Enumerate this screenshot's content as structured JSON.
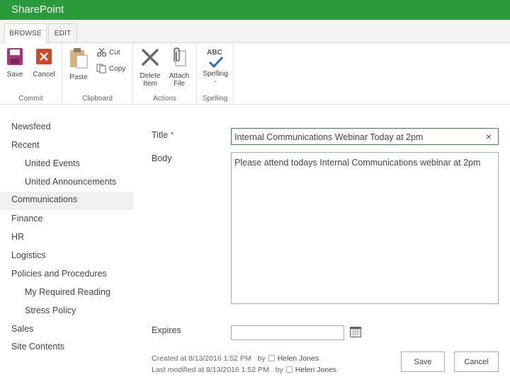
{
  "app": {
    "title": "SharePoint"
  },
  "ribbon_tabs": [
    {
      "label": "BROWSE"
    },
    {
      "label": "EDIT"
    }
  ],
  "ribbon": {
    "commit": {
      "label": "Commit",
      "save": "Save",
      "cancel": "Cancel"
    },
    "clipboard": {
      "label": "Clipboard",
      "paste": "Paste",
      "cut": "Cut",
      "copy": "Copy"
    },
    "actions": {
      "label": "Actions",
      "delete_line1": "Delete",
      "delete_line2": "Item",
      "attach_line1": "Attach",
      "attach_line2": "File"
    },
    "spelling": {
      "label": "Spelling",
      "button": "Spelling",
      "arrow": "-",
      "icon_text": "ABC"
    }
  },
  "nav": [
    {
      "label": "Newsfeed"
    },
    {
      "label": "Recent"
    },
    {
      "label": "United Events"
    },
    {
      "label": "United Announcements"
    },
    {
      "label": "Communications"
    },
    {
      "label": "Finance"
    },
    {
      "label": "HR"
    },
    {
      "label": "Logistics"
    },
    {
      "label": "Policies and Procedures"
    },
    {
      "label": "My Required Reading"
    },
    {
      "label": "Stress Policy"
    },
    {
      "label": "Sales"
    },
    {
      "label": "Site Contents"
    }
  ],
  "form": {
    "title_label": "Title",
    "required_mark": "*",
    "title_value": "Internal Communications Webinar Today at 2pm",
    "clear_glyph": "×",
    "body_label": "Body",
    "body_value": "Please attend todays Internal Communications webinar at 2pm",
    "expires_label": "Expires",
    "expires_value": ""
  },
  "meta": {
    "created_text": "Created at 8/13/2016 1:52 PM",
    "created_by_text": "by",
    "created_by": "Helen Jones",
    "modified_text": "Last modified at 8/13/2016 1:52 PM",
    "modified_by_text": "by",
    "modified_by": "Helen Jones"
  },
  "buttons": {
    "save": "Save",
    "cancel": "Cancel"
  },
  "colors": {
    "brand": "#2a9a3a",
    "save_icon": "#a4367a",
    "cancel_icon": "#d24726"
  }
}
